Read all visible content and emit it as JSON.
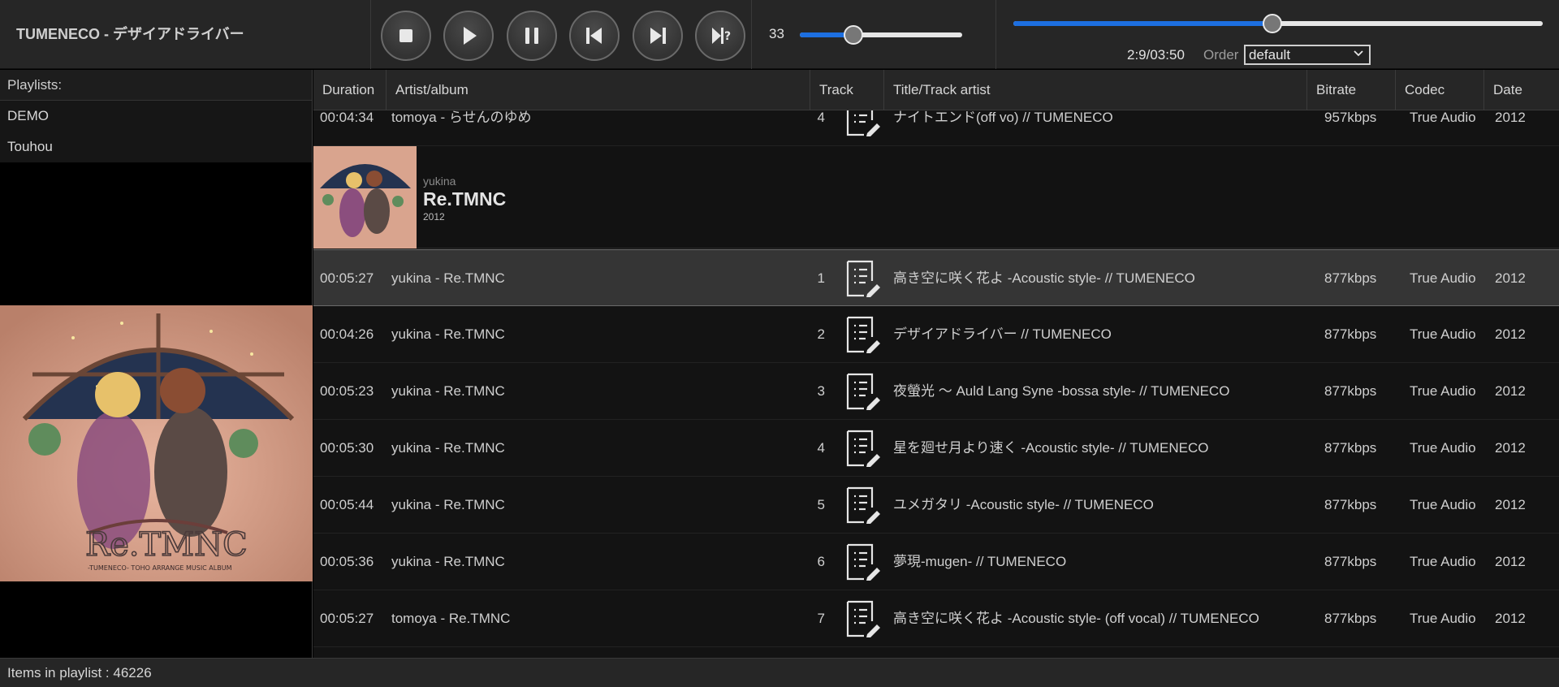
{
  "now_playing": {
    "title": "TUMENECO - デザイアドライバー"
  },
  "controls": {
    "stop": "stop-icon",
    "play": "play-icon",
    "pause": "pause-icon",
    "previous": "previous-icon",
    "next": "next-icon",
    "random": "random-icon"
  },
  "volume": {
    "value": "33",
    "level": 0.33
  },
  "seek": {
    "time": "2:9/03:50",
    "progress": 0.49
  },
  "order": {
    "label": "Order",
    "selected": "default"
  },
  "sidebar": {
    "header": "Playlists:",
    "playlists": [
      "DEMO",
      "Touhou"
    ]
  },
  "columns": {
    "duration": "Duration",
    "artist_album": "Artist/album",
    "track": "Track",
    "title": "Title/Track artist",
    "bitrate": "Bitrate",
    "codec": "Codec",
    "date": "Date"
  },
  "top_row": {
    "duration": "00:04:34",
    "artist_album": "tomoya - らせんのゆめ",
    "track": "4",
    "title": "ナイトエンド(off vo) // TUMENECO",
    "bitrate": "957kbps",
    "codec": "True Audio",
    "date": "2012"
  },
  "group": {
    "artist": "yukina",
    "album": "Re.TMNC",
    "year": "2012"
  },
  "rows": [
    {
      "duration": "00:05:27",
      "artist_album": "yukina - Re.TMNC",
      "track": "1",
      "title": "高き空に咲く花よ -Acoustic style- // TUMENECO",
      "bitrate": "877kbps",
      "codec": "True Audio",
      "date": "2012"
    },
    {
      "duration": "00:04:26",
      "artist_album": "yukina - Re.TMNC",
      "track": "2",
      "title": "デザイアドライバー // TUMENECO",
      "bitrate": "877kbps",
      "codec": "True Audio",
      "date": "2012"
    },
    {
      "duration": "00:05:23",
      "artist_album": "yukina - Re.TMNC",
      "track": "3",
      "title": "夜螢光 ～ Auld Lang Syne -bossa style- // TUMENECO",
      "bitrate": "877kbps",
      "codec": "True Audio",
      "date": "2012"
    },
    {
      "duration": "00:05:30",
      "artist_album": "yukina - Re.TMNC",
      "track": "4",
      "title": "星を廻せ月より速く -Acoustic style- // TUMENECO",
      "bitrate": "877kbps",
      "codec": "True Audio",
      "date": "2012"
    },
    {
      "duration": "00:05:44",
      "artist_album": "yukina - Re.TMNC",
      "track": "5",
      "title": "ユメガタリ -Acoustic style- // TUMENECO",
      "bitrate": "877kbps",
      "codec": "True Audio",
      "date": "2012"
    },
    {
      "duration": "00:05:36",
      "artist_album": "yukina - Re.TMNC",
      "track": "6",
      "title": "夢現-mugen- // TUMENECO",
      "bitrate": "877kbps",
      "codec": "True Audio",
      "date": "2012"
    },
    {
      "duration": "00:05:27",
      "artist_album": "tomoya - Re.TMNC",
      "track": "7",
      "title": "高き空に咲く花よ -Acoustic style- (off vocal) // TUMENECO",
      "bitrate": "877kbps",
      "codec": "True Audio",
      "date": "2012"
    }
  ],
  "cover_art": {
    "lettering": "Re.TMNC",
    "subtitle": "-TUMENECO- TOHO ARRANGE MUSIC ALBUM"
  },
  "status": {
    "items": "Items in playlist : 46226"
  },
  "colors": {
    "accent": "#1d6fe0",
    "selected_row": "#353535",
    "panel": "#262626",
    "list_bg": "#131313"
  },
  "selected_row_index": 0
}
